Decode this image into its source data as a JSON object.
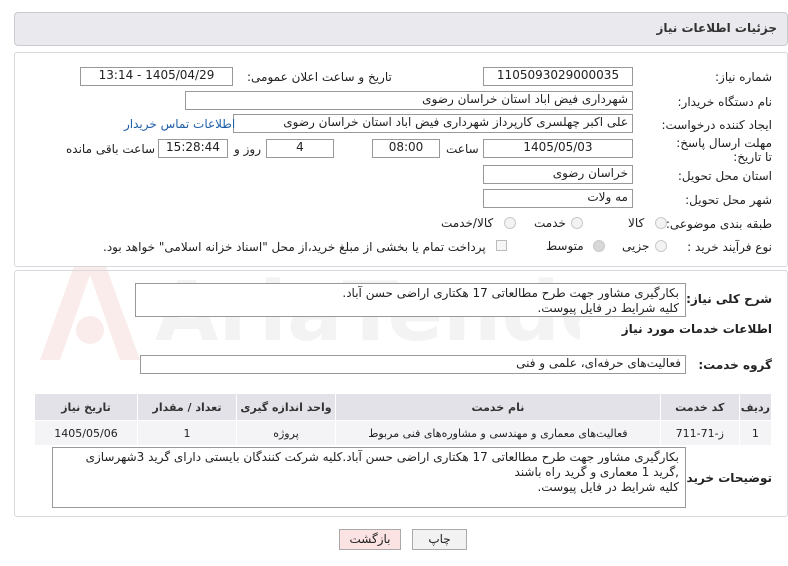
{
  "header": {
    "title": "جزئیات اطلاعات نیاز"
  },
  "fields": {
    "need_number_label": "شماره نیاز:",
    "need_number": "1105093029000035",
    "announce_label": "تاریخ و ساعت اعلان عمومی:",
    "announce_value": "1405/04/29 - 13:14",
    "buyer_org_label": "نام دستگاه خریدار:",
    "buyer_org": "شهرداری فیض اباد استان خراسان رضوی",
    "creator_label": "ایجاد کننده درخواست:",
    "creator": "علی اکبر چهلسری کارپرداز شهرداری فیض اباد استان خراسان رضوی",
    "contact_link": "اطلاعات تماس خریدار",
    "deadline_label": "مهلت ارسال پاسخ: تا تاریخ:",
    "deadline_date": "1405/05/03",
    "time_label": "ساعت",
    "deadline_time": "08:00",
    "days_value": "4",
    "days_label": "روز و",
    "remaining_time": "15:28:44",
    "remaining_label": "ساعت باقی مانده",
    "province_label": "استان محل تحویل:",
    "province": "خراسان رضوی",
    "city_label": "شهر محل تحویل:",
    "city": "مه ولات",
    "category_label": "طبقه بندی موضوعی:",
    "category_options": [
      "کالا",
      "خدمت",
      "کالا/خدمت"
    ],
    "process_label": "نوع فرآیند خرید :",
    "process_options": [
      "جزیی",
      "متوسط"
    ],
    "payment_note": "پرداخت تمام یا بخشی از مبلغ خرید،از محل \"اسناد خزانه اسلامی\" خواهد بود."
  },
  "summary": {
    "label": "شرح کلی نیاز:",
    "line1": "بکارگیری مشاور جهت طرح مطالعاتی 17 هکتاری اراضی حسن آباد.",
    "line2": "کلیه شرایط در فایل پیوست."
  },
  "services": {
    "section_title": "اطلاعات خدمات مورد نیاز",
    "group_label": "گروه خدمت:",
    "group_value": "فعالیت‌های حرفه‌ای، علمی و فنی",
    "columns": [
      "ردیف",
      "کد خدمت",
      "نام خدمت",
      "واحد اندازه گیری",
      "تعداد / مقدار",
      "تاریخ نیاز"
    ],
    "rows": [
      [
        "1",
        "ز-71-711",
        "فعالیت‌های معماری و مهندسی و مشاوره‌های فنی مربوط",
        "پروژه",
        "1",
        "1405/05/06"
      ]
    ]
  },
  "notes": {
    "label": "توضیحات خریدار:",
    "line1": "بکارگیری مشاور جهت طرح مطالعاتی 17 هکتاری اراضی حسن آباد.کلیه شرکت کنندگان بایستی دارای گرید 3شهرسازی",
    "line2": ",گرید 1 معماری و گرید راه باشند",
    "line3": "کلیه شرایط در فایل پیوست."
  },
  "buttons": {
    "print": "چاپ",
    "back": "بازگشت"
  },
  "watermark": {
    "text": "AriaTender.neT"
  },
  "colors": {
    "link": "#1f5fa8",
    "header_bg": "#e9e9ee",
    "back_button_bg": "#fbe3e3",
    "watermark_red": "#c0392b"
  }
}
